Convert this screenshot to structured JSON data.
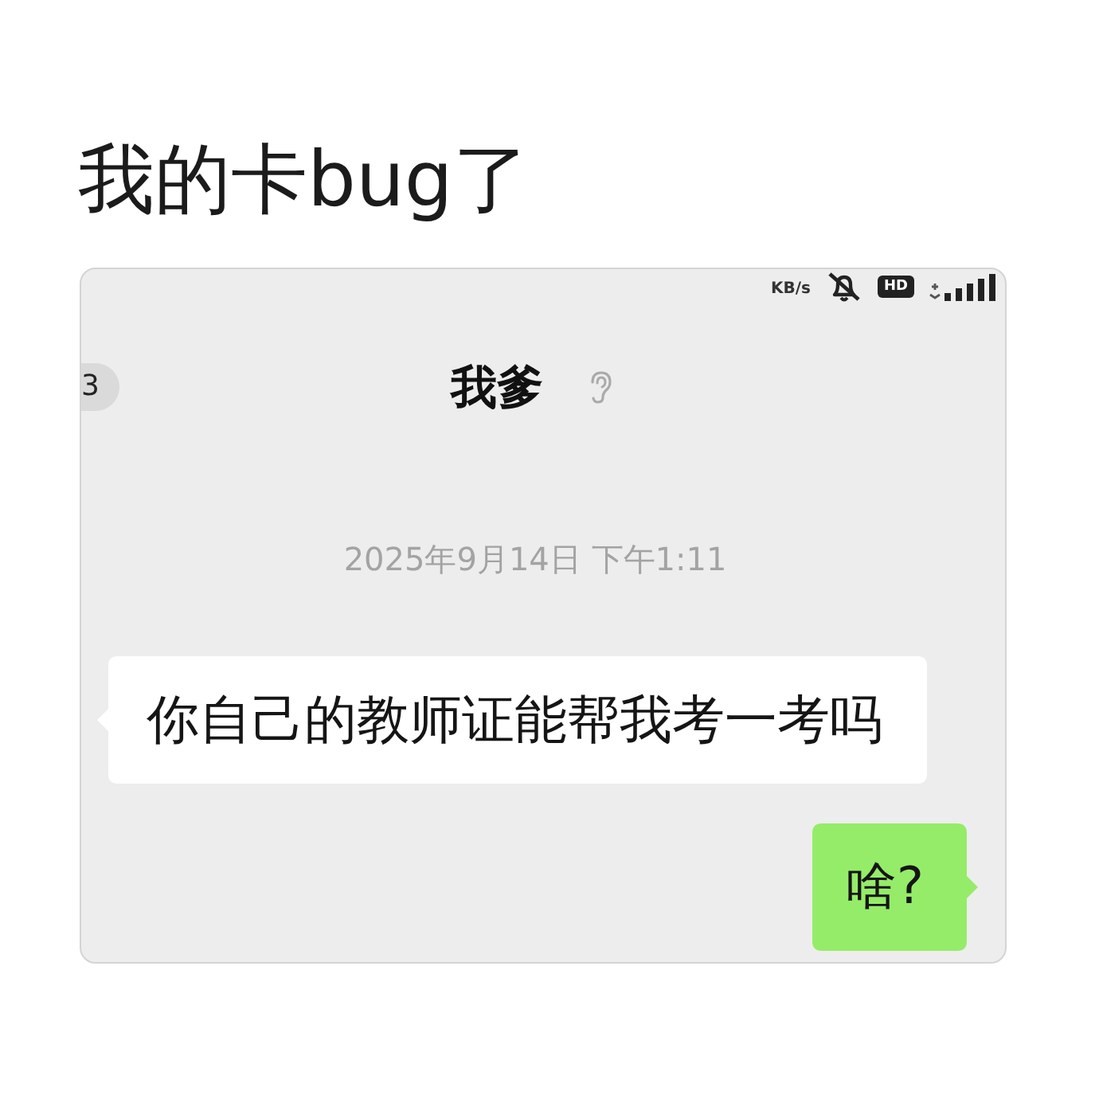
{
  "caption": "我的卡bug了",
  "status_bar": {
    "speed_unit": "KB/s",
    "hd_badge": "HD"
  },
  "chat_header": {
    "unread_count": "3",
    "title": "我爹"
  },
  "messages": [
    {
      "kind": "timestamp",
      "text": "2025年9月14日 下午1:11"
    },
    {
      "kind": "received",
      "text": "你自己的教师证能帮我考一考吗"
    },
    {
      "kind": "sent",
      "text": "啥?"
    }
  ]
}
